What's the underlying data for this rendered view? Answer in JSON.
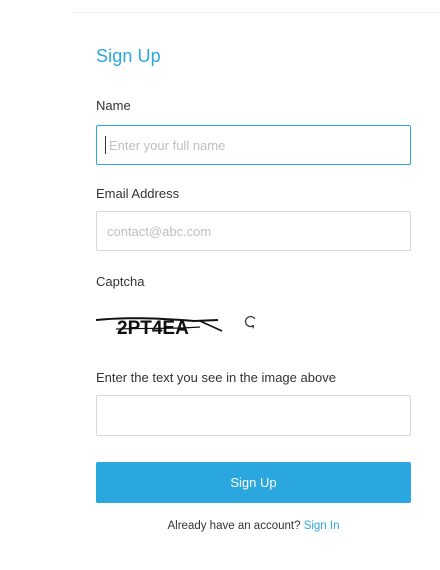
{
  "form": {
    "title": "Sign Up",
    "name_label": "Name",
    "name_placeholder": "Enter your full name",
    "email_label": "Email Address",
    "email_placeholder": "contact@abc.com",
    "captcha_label": "Captcha",
    "captcha_text": "2PT4EA",
    "captcha_prompt": "Enter the text you see in the image above",
    "submit_label": "Sign Up"
  },
  "footer": {
    "prompt_text": "Already have an account?",
    "signin_link": "Sign In"
  },
  "colors": {
    "accent": "#2aa7de",
    "input_border": "#d9d9d9",
    "text": "#333333",
    "placeholder": "#bfbfbf"
  },
  "icons": {
    "refresh": "refresh-icon"
  }
}
